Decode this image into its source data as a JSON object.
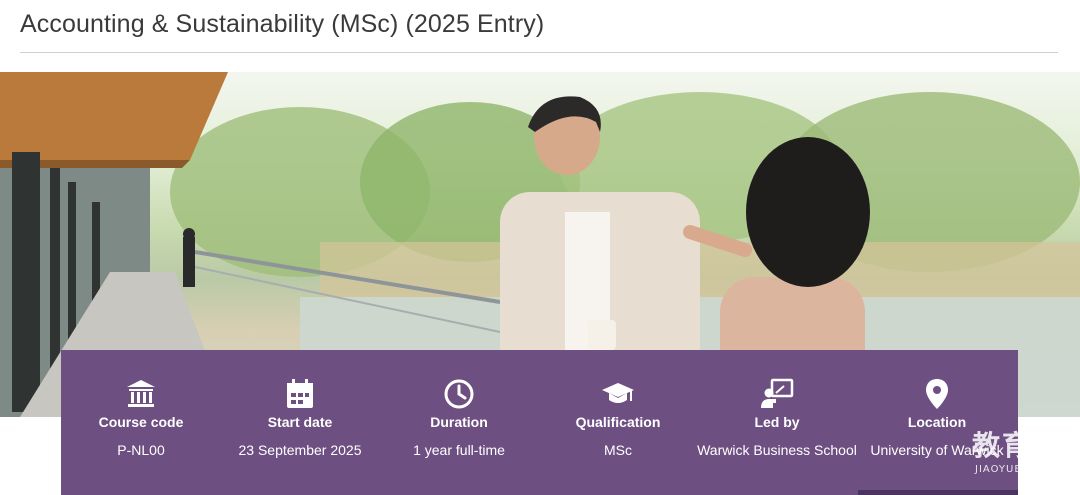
{
  "page": {
    "title": "Accounting & Sustainability (MSc) (2025 Entry)"
  },
  "hero": {
    "image_alt": "Two students talking on a campus bridge by a lake"
  },
  "course_details": [
    {
      "icon": "building-icon",
      "label": "Course code",
      "value": "P-NL00"
    },
    {
      "icon": "calendar-icon",
      "label": "Start date",
      "value": "23 September 2025"
    },
    {
      "icon": "clock-icon",
      "label": "Duration",
      "value": "1 year full-time"
    },
    {
      "icon": "graduation-cap-icon",
      "label": "Qualification",
      "value": "MSc"
    },
    {
      "icon": "presenter-icon",
      "label": "Led by",
      "value": "Warwick Business School"
    },
    {
      "icon": "location-pin-icon",
      "label": "Location",
      "value": "University of Warwick"
    }
  ],
  "watermark": {
    "cn": "教育宝",
    "en": "JIAOYUBAO.CN"
  },
  "colors": {
    "info_bar": "#6e4f82",
    "title_text": "#3a3a3a"
  }
}
